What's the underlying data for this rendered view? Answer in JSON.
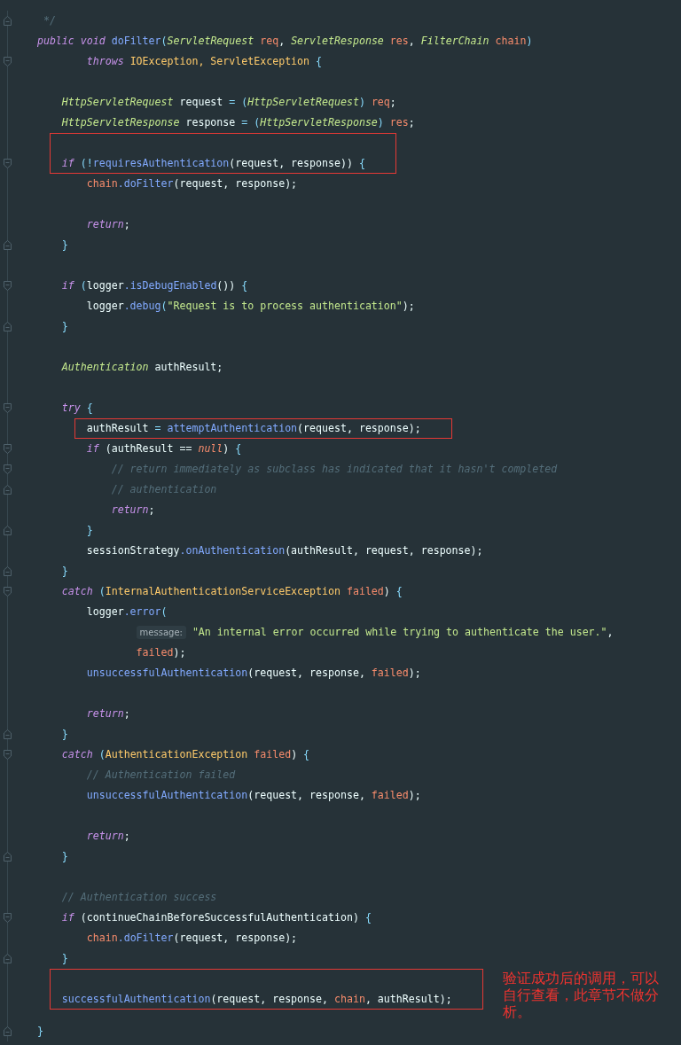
{
  "editor": {
    "blocks": [
      {
        "kind": "code",
        "fold_end": true,
        "tokens": [
          {
            "text": "     */",
            "kind": "comment"
          }
        ]
      },
      {
        "kind": "code",
        "tokens": [
          {
            "text": "    public void ",
            "kind": "keyword"
          },
          {
            "text": "doFilter",
            "kind": "method"
          },
          {
            "text": "(",
            "kind": "punct"
          },
          {
            "text": "ServletRequest ",
            "kind": "type"
          },
          {
            "text": "req",
            "kind": "param"
          },
          {
            "text": ", ",
            "kind": "plain"
          },
          {
            "text": "ServletResponse ",
            "kind": "type"
          },
          {
            "text": "res",
            "kind": "param"
          },
          {
            "text": ", ",
            "kind": "plain"
          },
          {
            "text": "FilterChain ",
            "kind": "type"
          },
          {
            "text": "chain",
            "kind": "param"
          },
          {
            "text": ")",
            "kind": "punct"
          }
        ]
      },
      {
        "kind": "code",
        "fold_start": true,
        "tokens": [
          {
            "text": "            throws ",
            "kind": "keyword"
          },
          {
            "text": "IOException, ServletException ",
            "kind": "class"
          },
          {
            "text": "{",
            "kind": "punct"
          }
        ]
      },
      {
        "kind": "blank"
      },
      {
        "kind": "code",
        "tokens": [
          {
            "text": "        HttpServletRequest ",
            "kind": "type"
          },
          {
            "text": "request ",
            "kind": "plain"
          },
          {
            "text": "= (",
            "kind": "punct"
          },
          {
            "text": "HttpServletRequest",
            "kind": "type"
          },
          {
            "text": ") ",
            "kind": "punct"
          },
          {
            "text": "req",
            "kind": "param"
          },
          {
            "text": ";",
            "kind": "plain"
          }
        ]
      },
      {
        "kind": "code",
        "tokens": [
          {
            "text": "        HttpServletResponse ",
            "kind": "type"
          },
          {
            "text": "response ",
            "kind": "plain"
          },
          {
            "text": "= (",
            "kind": "punct"
          },
          {
            "text": "HttpServletResponse",
            "kind": "type"
          },
          {
            "text": ") ",
            "kind": "punct"
          },
          {
            "text": "res",
            "kind": "param"
          },
          {
            "text": ";",
            "kind": "plain"
          }
        ]
      },
      {
        "kind": "callout",
        "lines": [
          {
            "kind": "blank"
          },
          {
            "kind": "code",
            "fold_start": true,
            "tokens": [
              {
                "text": "        if ",
                "kind": "keyword"
              },
              {
                "text": "(!",
                "kind": "punct"
              },
              {
                "text": "requiresAuthentication",
                "kind": "method"
              },
              {
                "text": "(request, response)) ",
                "kind": "plain"
              },
              {
                "text": "{",
                "kind": "punct"
              }
            ]
          }
        ]
      },
      {
        "kind": "code",
        "tokens": [
          {
            "text": "            chain",
            "kind": "param"
          },
          {
            "text": ".doFilter",
            "kind": "method"
          },
          {
            "text": "(request, response);",
            "kind": "plain"
          }
        ]
      },
      {
        "kind": "blank"
      },
      {
        "kind": "code",
        "tokens": [
          {
            "text": "            return",
            "kind": "keyword"
          },
          {
            "text": ";",
            "kind": "plain"
          }
        ]
      },
      {
        "kind": "code",
        "fold_end": true,
        "tokens": [
          {
            "text": "        }",
            "kind": "punct"
          }
        ]
      },
      {
        "kind": "blank"
      },
      {
        "kind": "code",
        "fold_start": true,
        "tokens": [
          {
            "text": "        if ",
            "kind": "keyword"
          },
          {
            "text": "(",
            "kind": "punct"
          },
          {
            "text": "logger",
            "kind": "plain"
          },
          {
            "text": ".isDebugEnabled",
            "kind": "method"
          },
          {
            "text": "()) ",
            "kind": "plain"
          },
          {
            "text": "{",
            "kind": "punct"
          }
        ]
      },
      {
        "kind": "code",
        "tokens": [
          {
            "text": "            logger",
            "kind": "plain"
          },
          {
            "text": ".debug",
            "kind": "method"
          },
          {
            "text": "(",
            "kind": "punct"
          },
          {
            "text": "\"Request is to process authentication\"",
            "kind": "string"
          },
          {
            "text": ");",
            "kind": "plain"
          }
        ]
      },
      {
        "kind": "code",
        "fold_end": true,
        "tokens": [
          {
            "text": "        }",
            "kind": "punct"
          }
        ]
      },
      {
        "kind": "blank"
      },
      {
        "kind": "code",
        "tokens": [
          {
            "text": "        Authentication ",
            "kind": "type"
          },
          {
            "text": "authResult;",
            "kind": "plain"
          }
        ]
      },
      {
        "kind": "blank"
      },
      {
        "kind": "code",
        "fold_start": true,
        "tokens": [
          {
            "text": "        try ",
            "kind": "keyword"
          },
          {
            "text": "{",
            "kind": "punct"
          }
        ]
      },
      {
        "kind": "callout",
        "lines": [
          {
            "kind": "code",
            "tokens": [
              {
                "text": "            authResult ",
                "kind": "plain"
              },
              {
                "text": "= ",
                "kind": "punct"
              },
              {
                "text": "attemptAuthentication",
                "kind": "method"
              },
              {
                "text": "(request, response);",
                "kind": "plain"
              }
            ]
          }
        ]
      },
      {
        "kind": "code",
        "fold_start": true,
        "tokens": [
          {
            "text": "            if ",
            "kind": "keyword"
          },
          {
            "text": "(authResult == ",
            "kind": "plain"
          },
          {
            "text": "null",
            "kind": "literal"
          },
          {
            "text": ") ",
            "kind": "plain"
          },
          {
            "text": "{",
            "kind": "punct"
          }
        ]
      },
      {
        "kind": "code",
        "fold_start": true,
        "tokens": [
          {
            "text": "                // return immediately as subclass has indicated that it hasn't completed",
            "kind": "comment"
          }
        ]
      },
      {
        "kind": "code",
        "fold_end": true,
        "tokens": [
          {
            "text": "                // authentication",
            "kind": "comment"
          }
        ]
      },
      {
        "kind": "code",
        "tokens": [
          {
            "text": "                return",
            "kind": "keyword"
          },
          {
            "text": ";",
            "kind": "plain"
          }
        ]
      },
      {
        "kind": "code",
        "fold_end": true,
        "tokens": [
          {
            "text": "            }",
            "kind": "punct"
          }
        ]
      },
      {
        "kind": "code",
        "tokens": [
          {
            "text": "            sessionStrategy",
            "kind": "plain"
          },
          {
            "text": ".onAuthentication",
            "kind": "method"
          },
          {
            "text": "(authResult, request, response);",
            "kind": "plain"
          }
        ]
      },
      {
        "kind": "code",
        "fold_end": true,
        "tokens": [
          {
            "text": "        }",
            "kind": "punct"
          }
        ]
      },
      {
        "kind": "code",
        "fold_start": true,
        "tokens": [
          {
            "text": "        catch ",
            "kind": "keyword"
          },
          {
            "text": "(",
            "kind": "punct"
          },
          {
            "text": "InternalAuthenticationServiceException ",
            "kind": "class"
          },
          {
            "text": "failed",
            "kind": "param"
          },
          {
            "text": ") ",
            "kind": "plain"
          },
          {
            "text": "{",
            "kind": "punct"
          }
        ]
      },
      {
        "kind": "code",
        "tokens": [
          {
            "text": "            logger",
            "kind": "plain"
          },
          {
            "text": ".error",
            "kind": "method"
          },
          {
            "text": "(",
            "kind": "punct"
          }
        ]
      },
      {
        "kind": "code",
        "tokens": [
          {
            "text": "message:",
            "kind": "hint"
          },
          {
            "text": " \"An internal error occurred while trying to authenticate the user.\"",
            "kind": "string"
          },
          {
            "text": ",",
            "kind": "plain"
          }
        ]
      },
      {
        "kind": "code",
        "tokens": [
          {
            "text": "                    failed",
            "kind": "param"
          },
          {
            "text": ");",
            "kind": "plain"
          }
        ]
      },
      {
        "kind": "code",
        "tokens": [
          {
            "text": "            unsuccessfulAuthentication",
            "kind": "method"
          },
          {
            "text": "(request, response, ",
            "kind": "plain"
          },
          {
            "text": "failed",
            "kind": "param"
          },
          {
            "text": ");",
            "kind": "plain"
          }
        ]
      },
      {
        "kind": "blank"
      },
      {
        "kind": "code",
        "tokens": [
          {
            "text": "            return",
            "kind": "keyword"
          },
          {
            "text": ";",
            "kind": "plain"
          }
        ]
      },
      {
        "kind": "code",
        "fold_end": true,
        "tokens": [
          {
            "text": "        }",
            "kind": "punct"
          }
        ]
      },
      {
        "kind": "code",
        "fold_start": true,
        "tokens": [
          {
            "text": "        catch ",
            "kind": "keyword"
          },
          {
            "text": "(",
            "kind": "punct"
          },
          {
            "text": "AuthenticationException ",
            "kind": "class"
          },
          {
            "text": "failed",
            "kind": "param"
          },
          {
            "text": ") ",
            "kind": "plain"
          },
          {
            "text": "{",
            "kind": "punct"
          }
        ]
      },
      {
        "kind": "code",
        "tokens": [
          {
            "text": "            // Authentication failed",
            "kind": "comment"
          }
        ]
      },
      {
        "kind": "code",
        "tokens": [
          {
            "text": "            unsuccessfulAuthentication",
            "kind": "method"
          },
          {
            "text": "(request, response, ",
            "kind": "plain"
          },
          {
            "text": "failed",
            "kind": "param"
          },
          {
            "text": ");",
            "kind": "plain"
          }
        ]
      },
      {
        "kind": "blank"
      },
      {
        "kind": "code",
        "tokens": [
          {
            "text": "            return",
            "kind": "keyword"
          },
          {
            "text": ";",
            "kind": "plain"
          }
        ]
      },
      {
        "kind": "code",
        "fold_end": true,
        "tokens": [
          {
            "text": "        }",
            "kind": "punct"
          }
        ]
      },
      {
        "kind": "blank"
      },
      {
        "kind": "code",
        "tokens": [
          {
            "text": "        // Authentication success",
            "kind": "comment"
          }
        ]
      },
      {
        "kind": "code",
        "fold_start": true,
        "tokens": [
          {
            "text": "        if ",
            "kind": "keyword"
          },
          {
            "text": "(continueChainBeforeSuccessfulAuthentication) ",
            "kind": "plain"
          },
          {
            "text": "{",
            "kind": "punct"
          }
        ]
      },
      {
        "kind": "code",
        "tokens": [
          {
            "text": "            chain",
            "kind": "param"
          },
          {
            "text": ".doFilter",
            "kind": "method"
          },
          {
            "text": "(request, response);",
            "kind": "plain"
          }
        ]
      },
      {
        "kind": "code",
        "fold_end": true,
        "tokens": [
          {
            "text": "        }",
            "kind": "punct"
          }
        ]
      },
      {
        "kind": "callout",
        "note": "验证成功后的调用，可以自行查看，此章节不做分析。",
        "lines": [
          {
            "kind": "blank"
          },
          {
            "kind": "code",
            "tokens": [
              {
                "text": "        successfulAuthentication",
                "kind": "method"
              },
              {
                "text": "(request, response, ",
                "kind": "plain"
              },
              {
                "text": "chain",
                "kind": "param"
              },
              {
                "text": ", authResult);",
                "kind": "plain"
              }
            ]
          }
        ]
      },
      {
        "kind": "code",
        "fold_end": true,
        "tokens": [
          {
            "text": "    }",
            "kind": "punct"
          }
        ]
      }
    ]
  }
}
